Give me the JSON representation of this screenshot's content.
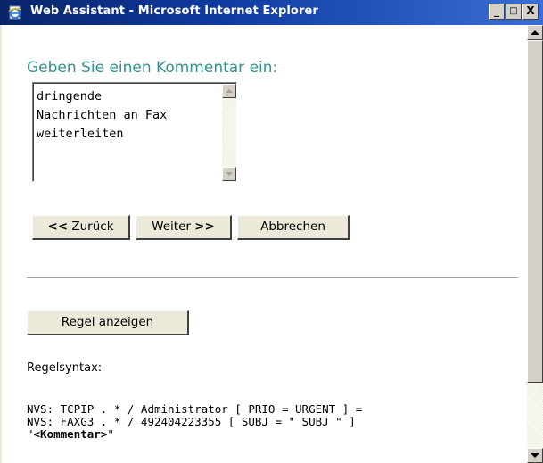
{
  "window": {
    "title": "Web Assistant - Microsoft Internet Explorer",
    "controls": {
      "minimize": "_",
      "maximize": "□",
      "close": "X"
    }
  },
  "page": {
    "heading": "Geben Sie einen Kommentar ein:",
    "comment": {
      "value": "dringende\nNachrichten an Fax\nweiterleiten"
    },
    "nav_buttons": {
      "back_chev": "<<",
      "back": "Zurück",
      "next": "Weiter",
      "next_chev": ">>",
      "cancel": "Abbrechen"
    },
    "show_rule_button": "Regel anzeigen",
    "syntax_label": "Regelsyntax:",
    "syntax_lines": [
      "NVS: TCPIP . * / Administrator [ PRIO = URGENT ] =",
      "NVS: FAXG3 . * / 492404223355 [ SUBJ = \" SUBJ \" ]"
    ],
    "syntax_last_quote_open": "\"",
    "syntax_placeholder": "<Kommentar>",
    "syntax_last_quote_close": "\""
  },
  "icons": {
    "title": "ie-page-icon",
    "scroll_up": "arrow-up-icon",
    "scroll_down": "arrow-down-icon"
  },
  "colors": {
    "heading": "#2f9390",
    "titlebar_start": "#0a246a",
    "titlebar_end": "#3a6ed6",
    "chrome": "#ece9d8"
  }
}
